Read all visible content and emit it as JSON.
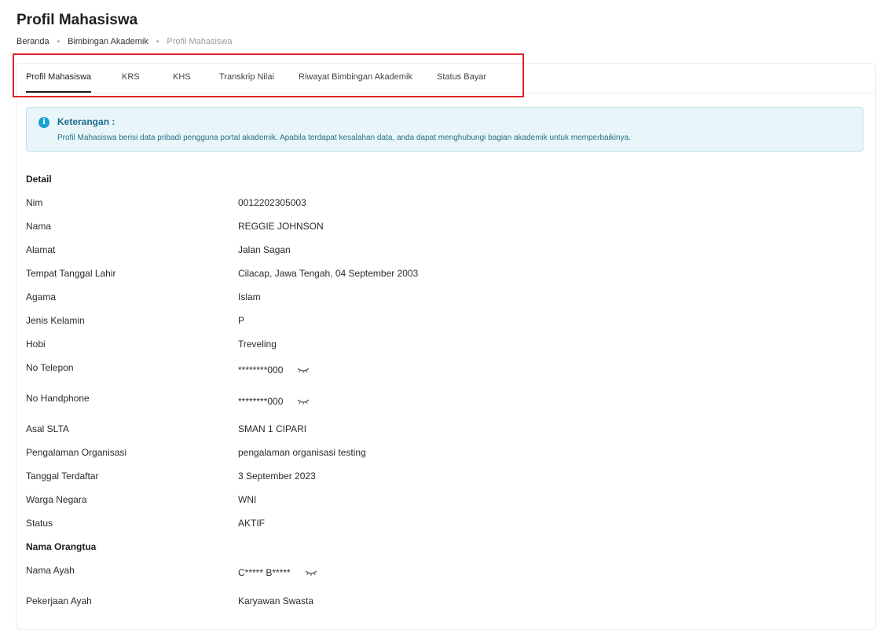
{
  "page": {
    "title": "Profil Mahasiswa"
  },
  "breadcrumb": {
    "items": [
      "Beranda",
      "Bimbingan Akademik",
      "Profil Mahasiswa"
    ],
    "separator": "•"
  },
  "tabs": [
    {
      "label": "Profil Mahasiswa",
      "active": true
    },
    {
      "label": "KRS"
    },
    {
      "label": "KHS"
    },
    {
      "label": "Transkrip Nilai"
    },
    {
      "label": "Riwayat Bimbingan Akademik"
    },
    {
      "label": "Status Bayar"
    }
  ],
  "alert": {
    "icon": "info-icon",
    "icon_glyph": "i",
    "title": "Keterangan :",
    "text": "Profil Mahasiswa berisi data pribadi pengguna portal akademik. Apabila terdapat kesalahan data, anda dapat menghubungi bagian akademik untuk memperbaikinya."
  },
  "detail": {
    "heading": "Detail",
    "fields": [
      {
        "label": "Nim",
        "value": "0012202305003"
      },
      {
        "label": "Nama",
        "value": "REGGIE JOHNSON"
      },
      {
        "label": "Alamat",
        "value": "Jalan Sagan"
      },
      {
        "label": "Tempat Tanggal Lahir",
        "value": "Cilacap, Jawa Tengah, 04 September 2003"
      },
      {
        "label": "Agama",
        "value": "Islam"
      },
      {
        "label": "Jenis Kelamin",
        "value": "P"
      },
      {
        "label": "Hobi",
        "value": "Treveling"
      },
      {
        "label": "No Telepon",
        "value": "********000",
        "masked": true
      },
      {
        "label": "No Handphone",
        "value": "********000",
        "masked": true
      },
      {
        "label": "Asal SLTA",
        "value": "SMAN 1 CIPARI"
      },
      {
        "label": "Pengalaman Organisasi",
        "value": "pengalaman organisasi testing"
      },
      {
        "label": "Tanggal Terdaftar",
        "value": "3 September 2023"
      },
      {
        "label": "Warga Negara",
        "value": "WNI"
      },
      {
        "label": "Status",
        "value": "AKTIF"
      }
    ]
  },
  "parents": {
    "heading": "Nama Orangtua",
    "fields": [
      {
        "label": "Nama Ayah",
        "value": "C***** B*****",
        "masked": true
      },
      {
        "label": "Pekerjaan Ayah",
        "value": "Karyawan Swasta"
      }
    ]
  },
  "colors": {
    "highlight": "#e0242b",
    "alert_bg": "#e8f6fa",
    "alert_text": "#2a6d86"
  }
}
